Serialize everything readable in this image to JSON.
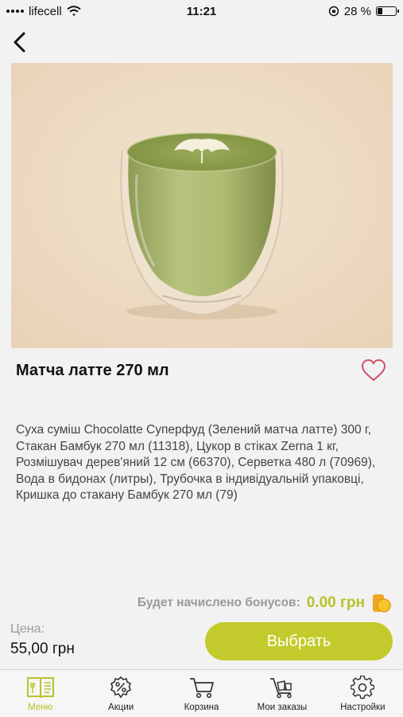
{
  "status_bar": {
    "carrier": "lifecell",
    "time": "11:21",
    "battery": "28 %",
    "battery_level": 0.28
  },
  "product": {
    "title": "Матча латте 270 мл",
    "description": "Суха суміш Chocolatte Суперфуд (Зелений матча латте) 300 г, Стакан Бамбук 270 мл (11318), Цукор в стіках Zerna 1 кг, Розмішувач дерев'яний 12 см (66370), Серветка 480 л (70969), Вода в бидонах (литры), Трубочка в індивідуальній упаковці, Кришка до стакану Бамбук 270 мл (79)"
  },
  "bonus": {
    "label": "Будет начислено бонусов:",
    "value": "0.00 грн"
  },
  "price": {
    "label": "Цена:",
    "value": "55,00 грн"
  },
  "select_button": "Выбрать",
  "tabs": [
    {
      "label": "Меню",
      "icon": "menu-book-icon",
      "active": true
    },
    {
      "label": "Акции",
      "icon": "discount-icon",
      "active": false
    },
    {
      "label": "Корзина",
      "icon": "cart-icon",
      "active": false
    },
    {
      "label": "Мои заказы",
      "icon": "orders-icon",
      "active": false
    },
    {
      "label": "Настройки",
      "icon": "gear-icon",
      "active": false
    }
  ],
  "colors": {
    "accent": "#c3cb2c",
    "accent_text": "#b9c22a",
    "heart": "#d0506a",
    "image_bg": "#eddcc4",
    "matcha": "#a7b66a"
  }
}
